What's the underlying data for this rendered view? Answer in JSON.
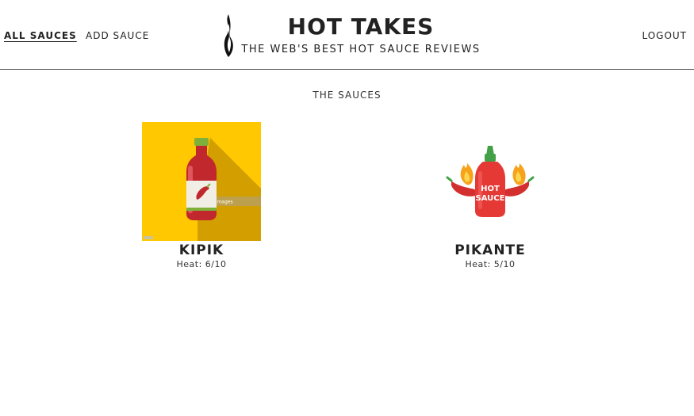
{
  "nav": {
    "all_sauces": "ALL SAUCES",
    "add_sauce": "ADD SAUCE",
    "logout": "LOGOUT"
  },
  "brand": {
    "title": "HOT TAKES",
    "subtitle": "THE WEB'S BEST HOT SAUCE REVIEWS"
  },
  "section": {
    "title": "THE SAUCES"
  },
  "sauces": [
    {
      "name": "KIPIK",
      "heat": "Heat: 6/10",
      "image_watermark": "gettyimages"
    },
    {
      "name": "PIKANTE",
      "heat": "Heat: 5/10",
      "label_line1": "HOT",
      "label_line2": "SAUCE"
    }
  ],
  "colors": {
    "text": "#222222",
    "card0_bg": "#FFC800",
    "bottle_red": "#C0282D",
    "cap_green": "#7FB03A",
    "pikante_red": "#E53935",
    "flame_orange": "#F7A21B"
  }
}
